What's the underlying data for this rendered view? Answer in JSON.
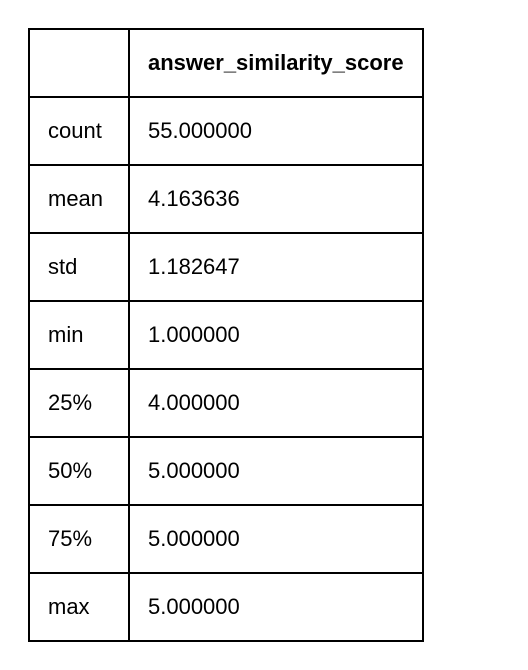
{
  "chart_data": {
    "type": "table",
    "column_header": "answer_similarity_score",
    "rows": [
      {
        "label": "count",
        "value": "55.000000"
      },
      {
        "label": "mean",
        "value": "4.163636"
      },
      {
        "label": "std",
        "value": "1.182647"
      },
      {
        "label": "min",
        "value": "1.000000"
      },
      {
        "label": "25%",
        "value": "4.000000"
      },
      {
        "label": "50%",
        "value": "5.000000"
      },
      {
        "label": "75%",
        "value": "5.000000"
      },
      {
        "label": "max",
        "value": "5.000000"
      }
    ]
  }
}
